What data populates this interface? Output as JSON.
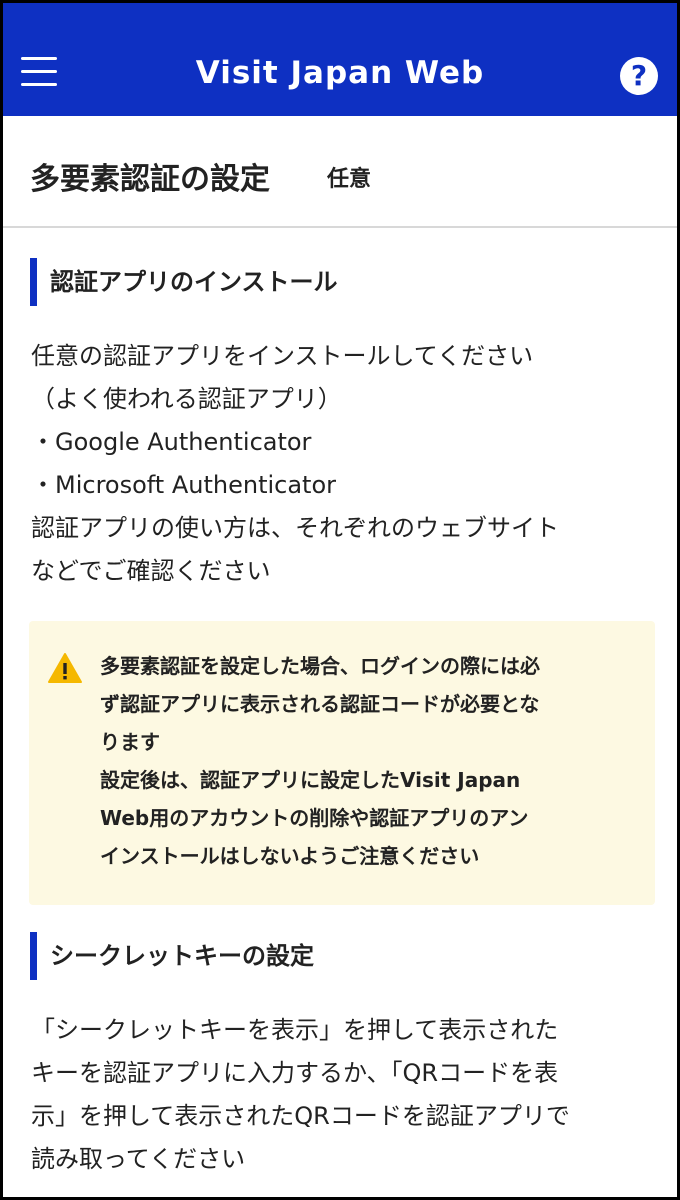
{
  "header": {
    "title": "Visit Japan Web",
    "help_label": "?"
  },
  "page": {
    "title": "多要素認証の設定",
    "optional_tag": "任意"
  },
  "install_section": {
    "heading": "認証アプリのインストール",
    "lines": [
      "任意の認証アプリをインストールしてください",
      "（よく使われる認証アプリ）",
      "・Google Authenticator",
      "・Microsoft Authenticator",
      "認証アプリの使い方は、それぞれのウェブサイト",
      "などでご確認ください"
    ]
  },
  "notice": {
    "icon": "warning-icon",
    "icon_color": "#f5b800",
    "lines": [
      "多要素認証を設定した場合、ログインの際には必",
      "ず認証アプリに表示される認証コードが必要とな",
      "ります",
      "設定後は、認証アプリに設定したVisit Japan",
      "Web用のアカウントの削除や認証アプリのアン",
      "インストールはしないようご注意ください"
    ]
  },
  "secret_section": {
    "heading": "シークレットキーの設定",
    "lines": [
      "「シークレットキーを表示」を押して表示された",
      "キーを認証アプリに入力するか、「QRコードを表",
      "示」を押して表示されたQRコードを認証アプリで",
      "読み取ってください"
    ]
  },
  "colors": {
    "brand": "#0e30c2",
    "notice_bg": "#fdf9e2"
  }
}
